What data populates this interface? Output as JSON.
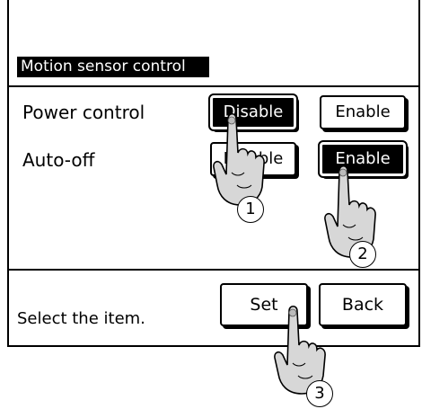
{
  "header": {
    "title": "Motion sensor control"
  },
  "rows": [
    {
      "label": "Power control",
      "disable_label": "Disable",
      "enable_label": "Enable",
      "selected": "disable"
    },
    {
      "label": "Auto-off",
      "disable_label": "Disable",
      "enable_label": "Enable",
      "selected": "enable"
    }
  ],
  "footer": {
    "status": "Select the item.",
    "set_label": "Set",
    "back_label": "Back"
  },
  "steps": [
    "1",
    "2",
    "3"
  ]
}
